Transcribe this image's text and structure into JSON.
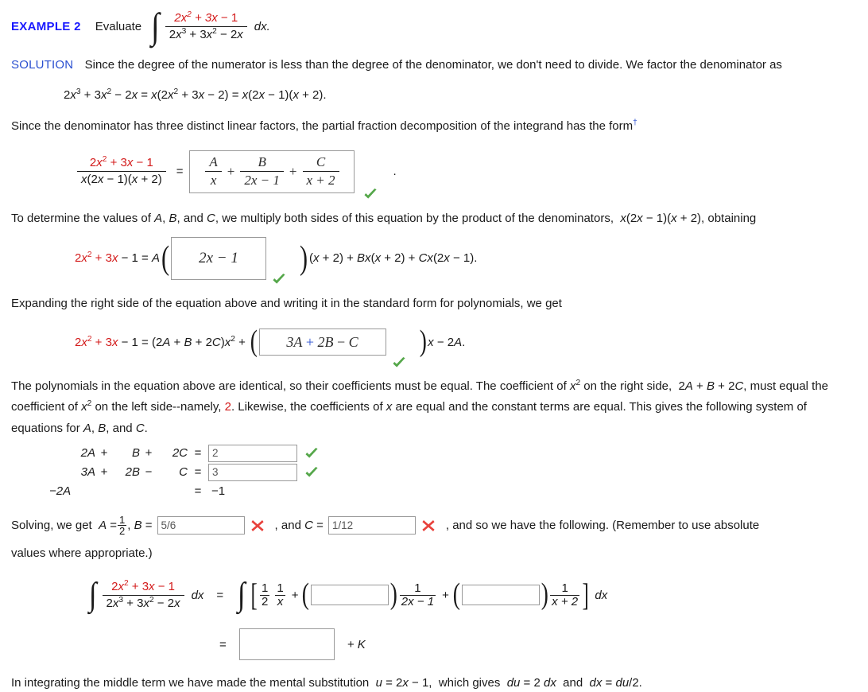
{
  "example": {
    "label": "EXAMPLE 2",
    "verb": "Evaluate",
    "integrand_num": "2x2 + 3x − 1",
    "integrand_den": "2x3 + 3x2 − 2x",
    "dx": "dx."
  },
  "solution": {
    "label": "SOLUTION",
    "intro": "Since the degree of the numerator is less than the degree of the denominator, we don't need to divide. We factor the denominator as",
    "factoring": "2x3 + 3x2 − 2x = x(2x2 + 3x − 2) = x(2x − 1)(x + 2).",
    "three_factors": "Since the denominator has three distinct linear factors, the partial fraction decomposition of the integrand has the form",
    "dagger": "†"
  },
  "decomposition": {
    "lhs_num": "2x2 + 3x − 1",
    "lhs_den": "x(2x − 1)(x + 2)",
    "equals": "=",
    "answer_terms": [
      {
        "num": "A",
        "den": "x"
      },
      {
        "num": "B",
        "den": "2x − 1"
      },
      {
        "num": "C",
        "den": "x + 2"
      }
    ],
    "plus": "+",
    "status": "correct",
    "period": "."
  },
  "multiply_step": {
    "text_before": "To determine the values of A, B, and C, we multiply both sides of this equation by the product of the denominators,  x(2x − 1)(x + 2), obtaining",
    "lhs": "2x2 + 3x − 1 = A",
    "box_value": "2x − 1",
    "status": "correct",
    "rhs": "(x + 2) + Bx(x + 2) + Cx(2x − 1)."
  },
  "expand_step": {
    "text": "Expanding the right side of the equation above and writing it in the standard form for polynomials, we get",
    "lhs": "2x2 + 3x − 1 = (2A + B + 2C)x2 + (",
    "box_value": "3A + 2B − C",
    "status": "correct",
    "rhs": ")x − 2A."
  },
  "coefficients_para": {
    "line1": "The polynomials in the equation above are identical, so their coefficients must be equal. The coefficient of x2 on the right side,  2A + B + 2C,",
    "line2_a": "must equal the coefficient of x2 on the left side--namely, ",
    "line2_value": "2",
    "line2_b": ". Likewise, the coefficients of x are equal and the constant terms are equal. This",
    "line3": "gives the following system of equations for A, B, and C."
  },
  "system": {
    "rows": [
      {
        "a": "2A",
        "op1": "+",
        "b": "B",
        "op2": "+",
        "c": "2C",
        "eq": "=",
        "value": "2",
        "status": "correct",
        "has_input": true
      },
      {
        "a": "3A",
        "op1": "+",
        "b": "2B",
        "op2": "−",
        "c": "C",
        "eq": "=",
        "value": "3",
        "status": "correct",
        "has_input": true
      },
      {
        "a": "−2A",
        "op1": "",
        "b": "",
        "op2": "",
        "c": "",
        "eq": "=",
        "value": "−1",
        "status": "none",
        "has_input": false
      }
    ]
  },
  "solving": {
    "prefix": "Solving, we get  A =",
    "a_num": "1",
    "a_den": "2",
    "b_label": ", B =",
    "b_value": "5/6",
    "b_status": "incorrect",
    "c_label": ", and C =",
    "c_value": "1/12",
    "c_status": "incorrect",
    "suffix": ",  and so we have the following. (Remember to use absolute",
    "suffix2": "values where appropriate.)"
  },
  "final_integral": {
    "lhs_num": "2x2 + 3x − 1",
    "lhs_den": "2x3 + 3x2 − 2x",
    "dx": "dx",
    "equals": "=",
    "half_num": "1",
    "half_den": "2",
    "invx_num": "1",
    "invx_den": "x",
    "plus": "+",
    "term2_num": "1",
    "term2_den": "2x − 1",
    "term3_num": "1",
    "term3_den": "x + 2",
    "dx_end": "dx",
    "box1_value": "",
    "box2_value": ""
  },
  "final_answer": {
    "equals": "=",
    "value": "",
    "plus_k": "+ K"
  },
  "footer": {
    "text": "In integrating the middle term we have made the mental substitution  u = 2x − 1,  which gives  du = 2 dx  and  dx = du/2."
  },
  "colors": {
    "heading_blue": "#1a1aff",
    "solution_blue": "#2a4fd0",
    "numerator_red": "#d31b1b",
    "check_green": "#55a74a",
    "cross_red": "#e8413c",
    "box_border": "#9a9a9a",
    "text": "#1a1a1a"
  },
  "icons": {
    "correct": "check-icon",
    "incorrect": "cross-icon"
  }
}
